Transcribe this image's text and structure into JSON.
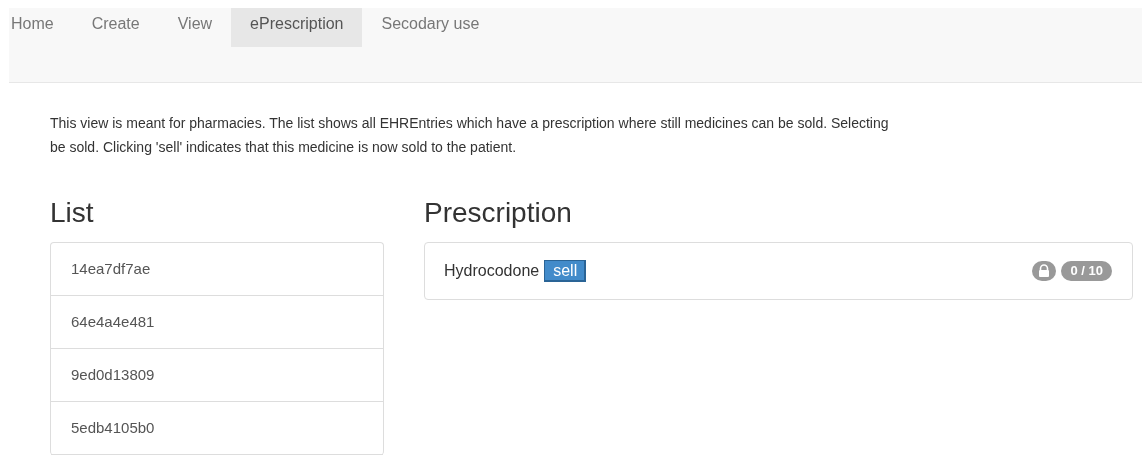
{
  "nav": {
    "tabs": [
      {
        "label": "Home",
        "selected": false
      },
      {
        "label": "Create",
        "selected": false
      },
      {
        "label": "View",
        "selected": false
      },
      {
        "label": "ePrescription",
        "selected": true
      },
      {
        "label": "Secodary use",
        "selected": false
      }
    ]
  },
  "intro": [
    "This view is meant for pharmacies. The list shows all EHREntries which have a prescription where still medicines can be sold. Selecting",
    "be sold. Clicking 'sell' indicates that this medicine is now sold to the patient."
  ],
  "list": {
    "title": "List",
    "items": [
      "14ea7df7ae",
      "64e4a4e481",
      "9ed0d13809",
      "5edb4105b0"
    ]
  },
  "prescription": {
    "title": "Prescription",
    "items": [
      {
        "medicine": "Hydrocodone",
        "button": "sell",
        "count": "0 / 10"
      }
    ]
  }
}
